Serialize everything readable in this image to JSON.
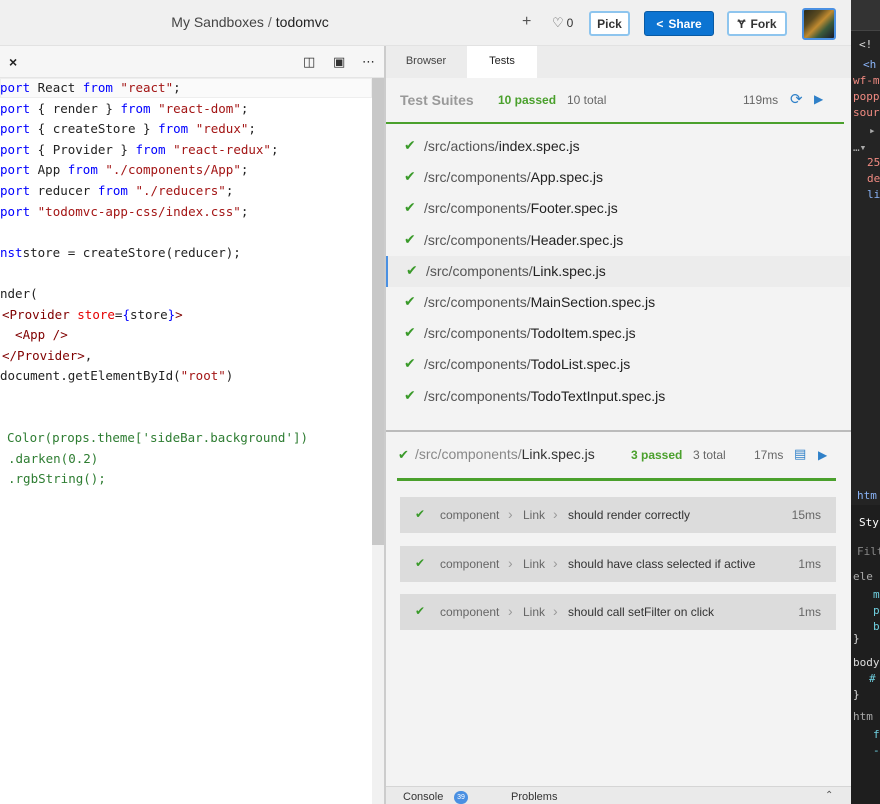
{
  "header": {
    "crumb": "My Sandboxes",
    "separator": "/",
    "project": "todomvc",
    "plus": "+",
    "like_count": "0",
    "pick_label": "Pick",
    "share_label": "Share",
    "fork_label": "Fork"
  },
  "editor": {
    "close": "×",
    "lines": [
      [
        [
          "kw",
          "port"
        ],
        [
          "",
          "React "
        ],
        [
          "kw",
          "from"
        ],
        [
          "str",
          " \"react\""
        ],
        [
          "",
          ";"
        ]
      ],
      [
        [
          "kw",
          "port"
        ],
        [
          "",
          "{ render } "
        ],
        [
          "kw",
          "from"
        ],
        [
          "str",
          " \"react-dom\""
        ],
        [
          "",
          ";"
        ]
      ],
      [
        [
          "kw",
          "port"
        ],
        [
          "",
          "{ createStore } "
        ],
        [
          "kw",
          "from"
        ],
        [
          "str",
          " \"redux\""
        ],
        [
          "",
          ";"
        ]
      ],
      [
        [
          "kw",
          "port"
        ],
        [
          "",
          "{ Provider } "
        ],
        [
          "kw",
          "from"
        ],
        [
          "str",
          " \"react-redux\""
        ],
        [
          "",
          ";"
        ]
      ],
      [
        [
          "kw",
          "port"
        ],
        [
          "",
          "App "
        ],
        [
          "kw",
          "from"
        ],
        [
          "str",
          " \"./components/App\""
        ],
        [
          "",
          ";"
        ]
      ],
      [
        [
          "kw",
          "port"
        ],
        [
          "",
          "reducer "
        ],
        [
          "kw",
          "from"
        ],
        [
          "str",
          " \"./reducers\""
        ],
        [
          "",
          ";"
        ]
      ],
      [
        [
          "kw",
          "port"
        ],
        [
          "str",
          "\"todomvc-app-css/index.css\""
        ],
        [
          "",
          ";"
        ]
      ],
      [],
      [
        [
          "kw",
          "nst"
        ],
        [
          "",
          ""
        ],
        [
          "",
          "store = createStore(reducer);"
        ]
      ],
      [],
      [
        [
          "",
          "nder("
        ]
      ],
      [
        [
          "tag",
          "<Provider"
        ],
        [
          "",
          " "
        ],
        [
          "attr",
          "store"
        ],
        [
          "",
          "="
        ],
        [
          "kw",
          "{"
        ],
        [
          "",
          "store"
        ],
        [
          "kw",
          "}"
        ],
        [
          "tag",
          ">"
        ]
      ],
      [
        [
          "",
          ""
        ],
        [
          "tag",
          "  <App />"
        ]
      ],
      [
        [
          "tag",
          "</Provider>"
        ],
        [
          "",
          ","
        ]
      ],
      [
        [
          "",
          "document.getElementById("
        ],
        [
          "str",
          "\"root\""
        ],
        [
          "",
          ")"
        ]
      ],
      [],
      [],
      [
        [
          "fn",
          "Color(props.theme['sideBar.background'])"
        ]
      ],
      [
        [
          "fn",
          ".darken(0.2)"
        ]
      ],
      [
        [
          "fn",
          ".rgbString();"
        ]
      ]
    ]
  },
  "tabs": {
    "browser": "Browser",
    "tests": "Tests"
  },
  "suites": {
    "label": "Test Suites",
    "passed": "10 passed",
    "total": "10 total",
    "time": "119ms",
    "items": [
      {
        "dir": "/src/actions/",
        "file": "index.spec.js"
      },
      {
        "dir": "/src/components/",
        "file": "App.spec.js"
      },
      {
        "dir": "/src/components/",
        "file": "Footer.spec.js"
      },
      {
        "dir": "/src/components/",
        "file": "Header.spec.js"
      },
      {
        "dir": "/src/components/",
        "file": "Link.spec.js"
      },
      {
        "dir": "/src/components/",
        "file": "MainSection.spec.js"
      },
      {
        "dir": "/src/components/",
        "file": "TodoItem.spec.js"
      },
      {
        "dir": "/src/components/",
        "file": "TodoList.spec.js"
      },
      {
        "dir": "/src/components/",
        "file": "TodoTextInput.spec.js"
      }
    ]
  },
  "file": {
    "dir": "/src/components/",
    "name": "Link.spec.js",
    "passed": "3 passed",
    "total": "3 total",
    "time": "17ms",
    "tests": [
      {
        "c1": "component",
        "c2": "Link",
        "name": "should render correctly",
        "time": "15ms"
      },
      {
        "c1": "component",
        "c2": "Link",
        "name": "should have class selected if active",
        "time": "1ms"
      },
      {
        "c1": "component",
        "c2": "Link",
        "name": "should call setFilter on click",
        "time": "1ms"
      }
    ]
  },
  "bottom": {
    "console": "Console",
    "badge": "39",
    "problems": "Problems"
  },
  "devtools": {
    "lines": [
      "<!",
      "<h",
      "wf-m",
      "popp",
      "sour",
      "▸",
      "…▾",
      "25",
      "de",
      "li",
      "htm",
      "Sty",
      "Filte",
      "ele",
      "m",
      "p",
      "b",
      "}",
      "body",
      "#",
      "}",
      "htm",
      "f",
      "-"
    ]
  }
}
